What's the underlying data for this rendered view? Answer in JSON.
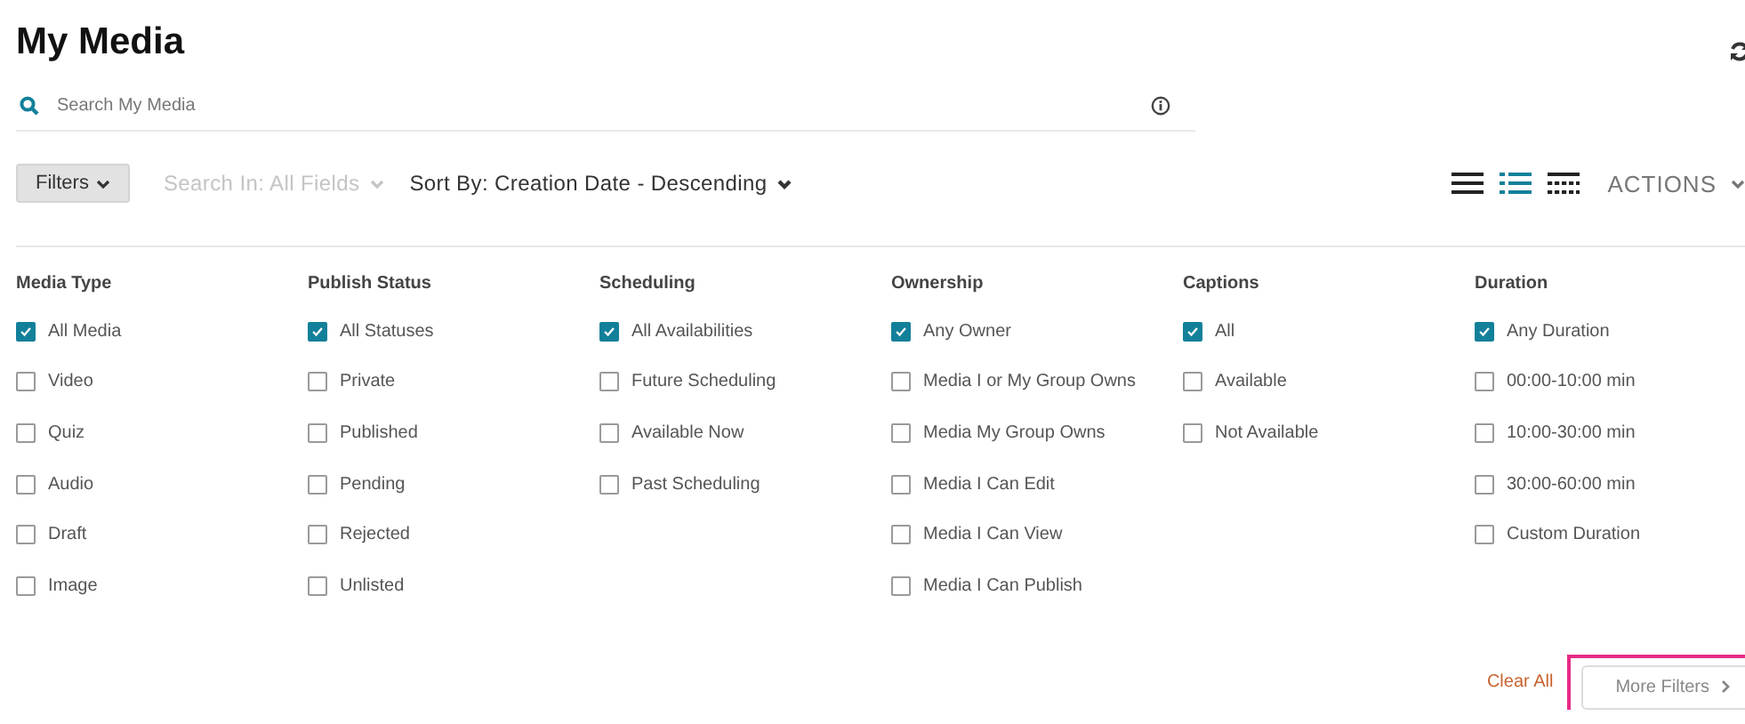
{
  "page": {
    "title": "My Media"
  },
  "search": {
    "placeholder": "Search My Media"
  },
  "toolbar": {
    "filters_button": {
      "label": "Filters",
      "expanded": true
    },
    "search_in": {
      "label": "Search In: All Fields",
      "disabled": true
    },
    "sort_by": {
      "label": "Sort By: Creation Date - Descending"
    },
    "actions": {
      "label": "ACTIONS"
    }
  },
  "views": [
    {
      "kind": "list",
      "selected": false
    },
    {
      "kind": "detailed",
      "selected": true
    },
    {
      "kind": "grid",
      "selected": false
    }
  ],
  "filter_groups": [
    {
      "title": "Media Type",
      "options": [
        {
          "label": "All Media",
          "checked": true
        },
        {
          "label": "Video",
          "checked": false
        },
        {
          "label": "Quiz",
          "checked": false
        },
        {
          "label": "Audio",
          "checked": false
        },
        {
          "label": "Draft",
          "checked": false
        },
        {
          "label": "Image",
          "checked": false
        }
      ]
    },
    {
      "title": "Publish Status",
      "options": [
        {
          "label": "All Statuses",
          "checked": true
        },
        {
          "label": "Private",
          "checked": false
        },
        {
          "label": "Published",
          "checked": false
        },
        {
          "label": "Pending",
          "checked": false
        },
        {
          "label": "Rejected",
          "checked": false
        },
        {
          "label": "Unlisted",
          "checked": false
        }
      ]
    },
    {
      "title": "Scheduling",
      "options": [
        {
          "label": "All Availabilities",
          "checked": true
        },
        {
          "label": "Future Scheduling",
          "checked": false
        },
        {
          "label": "Available Now",
          "checked": false
        },
        {
          "label": "Past Scheduling",
          "checked": false
        }
      ]
    },
    {
      "title": "Ownership",
      "options": [
        {
          "label": "Any Owner",
          "checked": true
        },
        {
          "label": "Media I or My Group Owns",
          "checked": false
        },
        {
          "label": "Media My Group Owns",
          "checked": false
        },
        {
          "label": "Media I Can Edit",
          "checked": false
        },
        {
          "label": "Media I Can View",
          "checked": false
        },
        {
          "label": "Media I Can Publish",
          "checked": false
        }
      ]
    },
    {
      "title": "Captions",
      "options": [
        {
          "label": "All",
          "checked": true
        },
        {
          "label": "Available",
          "checked": false
        },
        {
          "label": "Not Available",
          "checked": false
        }
      ]
    },
    {
      "title": "Duration",
      "options": [
        {
          "label": "Any Duration",
          "checked": true
        },
        {
          "label": "00:00-10:00 min",
          "checked": false
        },
        {
          "label": "10:00-30:00 min",
          "checked": false
        },
        {
          "label": "30:00-60:00 min",
          "checked": false
        },
        {
          "label": "Custom Duration",
          "checked": false
        }
      ]
    }
  ],
  "footer": {
    "clear_all": "Clear All",
    "more_filters": {
      "label": "More Filters",
      "highlighted": true
    }
  }
}
